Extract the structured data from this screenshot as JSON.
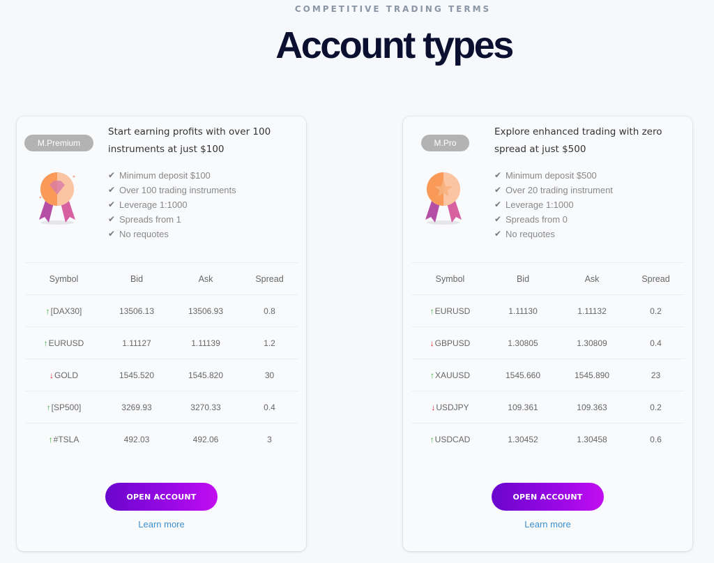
{
  "header": {
    "eyebrow": "COMPETITIVE TRADING TERMS",
    "title": "Account types"
  },
  "accounts": [
    {
      "badge": "M.Premium",
      "medal_icon": "diamond-medal-icon",
      "headline": "Start earning profits with over 100 instruments at just $100",
      "features": [
        "Minimum deposit $100",
        "Over 100 trading instruments",
        "Leverage 1:1000",
        "Spreads from 1",
        "No requotes"
      ],
      "table": {
        "headers": [
          "Symbol",
          "Bid",
          "Ask",
          "Spread"
        ],
        "rows": [
          {
            "direction": "up",
            "symbol": "[DAX30]",
            "bid": "13506.13",
            "ask": "13506.93",
            "spread": "0.8"
          },
          {
            "direction": "up",
            "symbol": "EURUSD",
            "bid": "1.11127",
            "ask": "1.11139",
            "spread": "1.2"
          },
          {
            "direction": "down",
            "symbol": "GOLD",
            "bid": "1545.520",
            "ask": "1545.820",
            "spread": "30"
          },
          {
            "direction": "up",
            "symbol": "[SP500]",
            "bid": "3269.93",
            "ask": "3270.33",
            "spread": "0.4"
          },
          {
            "direction": "up",
            "symbol": "#TSLA",
            "bid": "492.03",
            "ask": "492.06",
            "spread": "3"
          }
        ]
      },
      "cta": "OPEN ACCOUNT",
      "learn_more": "Learn more"
    },
    {
      "badge": "M.Pro",
      "medal_icon": "star-medal-icon",
      "headline": "Explore enhanced trading with zero spread at just $500",
      "features": [
        "Minimum deposit $500",
        "Over 20 trading instrument",
        "Leverage 1:1000",
        "Spreads from 0",
        "No requotes"
      ],
      "table": {
        "headers": [
          "Symbol",
          "Bid",
          "Ask",
          "Spread"
        ],
        "rows": [
          {
            "direction": "up",
            "symbol": "EURUSD",
            "bid": "1.11130",
            "ask": "1.11132",
            "spread": "0.2"
          },
          {
            "direction": "down",
            "symbol": "GBPUSD",
            "bid": "1.30805",
            "ask": "1.30809",
            "spread": "0.4"
          },
          {
            "direction": "up",
            "symbol": "XAUUSD",
            "bid": "1545.660",
            "ask": "1545.890",
            "spread": "23"
          },
          {
            "direction": "down",
            "symbol": "USDJPY",
            "bid": "109.361",
            "ask": "109.363",
            "spread": "0.2"
          },
          {
            "direction": "up",
            "symbol": "USDCAD",
            "bid": "1.30452",
            "ask": "1.30458",
            "spread": "0.6"
          }
        ]
      },
      "cta": "OPEN ACCOUNT",
      "learn_more": "Learn more"
    }
  ],
  "icons": {
    "check": "✔",
    "arrow_up": "↑",
    "arrow_down": "↓"
  },
  "colors": {
    "up": "#3bad3b",
    "down": "#e0202a",
    "cta_start": "#6a06cc",
    "cta_end": "#c30ef0",
    "link": "#3b8fd0",
    "title": "#0b1030"
  }
}
